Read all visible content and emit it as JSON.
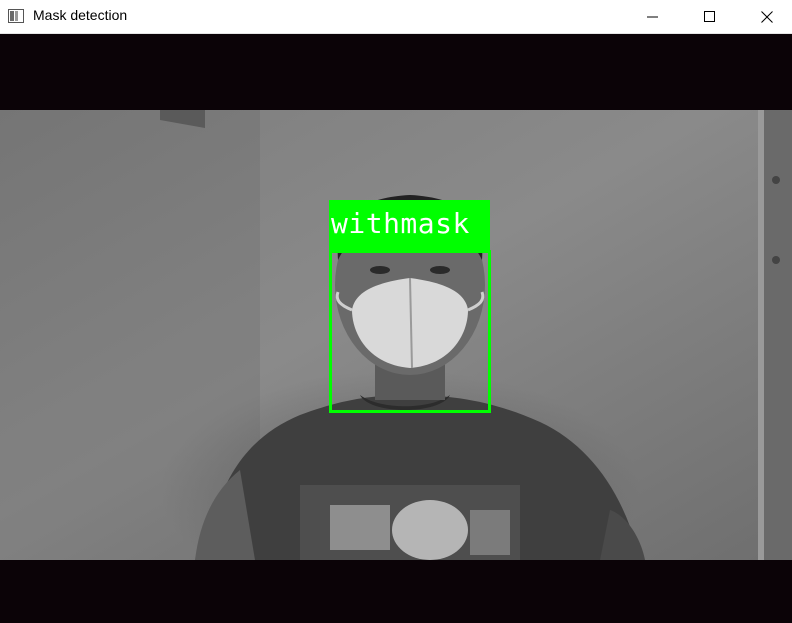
{
  "window": {
    "title": "Mask detection",
    "controls": {
      "minimize": "minimize",
      "maximize": "maximize",
      "close": "close"
    }
  },
  "detection": {
    "label": "withmask",
    "box_color": "#00ff00",
    "label_text_color": "#ffffff"
  },
  "colors": {
    "letterbox": "#0b0307"
  }
}
